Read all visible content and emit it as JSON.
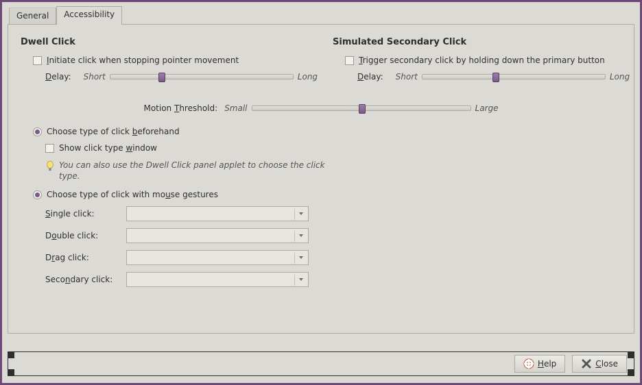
{
  "tabs": {
    "general": "General",
    "accessibility": "Accessibility"
  },
  "dwell": {
    "title": "Dwell Click",
    "initiate": "nitiate click when stopping pointer movement",
    "initiate_u": "I",
    "delay_label_pre": "",
    "delay_u": "D",
    "delay_label_post": "elay:",
    "short": "Short",
    "long": "Long",
    "choose_before_pre": "Choose type of click ",
    "choose_before_u": "b",
    "choose_before_post": "eforehand",
    "show_window_pre": "Show click type ",
    "show_window_u": "w",
    "show_window_post": "indow",
    "hint": "You can also use the Dwell Click panel applet to choose the click type.",
    "choose_gesture_pre": "Choose type of click with mo",
    "choose_gesture_u": "u",
    "choose_gesture_post": "se gestures",
    "single_pre": "",
    "single_u": "S",
    "single_post": "ingle click:",
    "double_pre": "D",
    "double_u": "o",
    "double_post": "uble click:",
    "drag_pre": "D",
    "drag_u": "r",
    "drag_post": "ag click:",
    "secondary_pre": "Seco",
    "secondary_u": "n",
    "secondary_post": "dary click:"
  },
  "sim": {
    "title": "Simulated Secondary Click",
    "trigger_u": "T",
    "trigger_post": "rigger secondary click by holding down the primary button",
    "delay_u": "D",
    "delay_post": "elay:",
    "short": "Short",
    "long": "Long"
  },
  "motion": {
    "pre": "Motion ",
    "u": "T",
    "post": "hreshold:",
    "small": "Small",
    "large": "Large"
  },
  "buttons": {
    "help_u": "H",
    "help_post": "elp",
    "close_u": "C",
    "close_post": "lose"
  },
  "sliders": {
    "dwell_delay_pct": 28,
    "sim_delay_pct": 40,
    "motion_pct": 50
  }
}
